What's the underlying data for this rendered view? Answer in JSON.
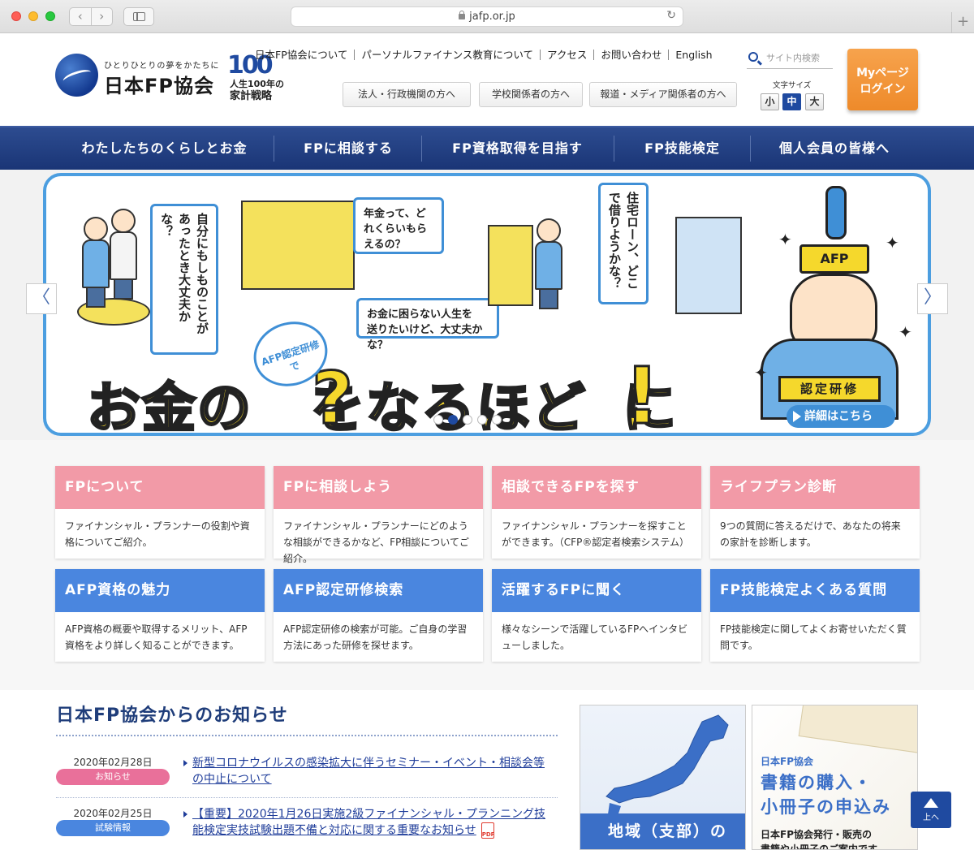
{
  "browser": {
    "url": "jafp.or.jp",
    "back": "‹",
    "forward": "›",
    "new_tab": "+"
  },
  "header": {
    "logo_tagline": "ひとりひとりの夢をかたちに",
    "logo_name": "日本FP協会",
    "centennial_mark": "100",
    "centennial_line1": "人生100年の",
    "centennial_line2": "家計戦略",
    "top_links": [
      "日本FP協会について",
      "パーソナルファイナンス教育について",
      "アクセス",
      "お問い合わせ",
      "English"
    ],
    "search_placeholder": "サイト内検索",
    "audience_buttons": [
      "法人・行政機関の方へ",
      "学校関係者の方へ",
      "報道・メディア関係者の方へ"
    ],
    "font_size_label": "文字サイズ",
    "font_sizes": [
      "小",
      "中",
      "大"
    ],
    "font_size_selected": "中",
    "mypage_line1": "Myページ",
    "mypage_line2": "ログイン"
  },
  "main_nav": [
    "わたしたちのくらしとお金",
    "FPに相談する",
    "FP資格取得を目指す",
    "FP技能検定",
    "個人会員の皆様へ"
  ],
  "hero": {
    "bubble1": "自分にもしものことがあったとき大丈夫かな？",
    "bubble2": "年金って、どれくらいもらえるの？",
    "bubble3_line1": "お金に困らない人生を",
    "bubble3_line2": "送りたいけど、大丈夫かな？",
    "bubble4": "住宅ローン、どこで借りようかな？",
    "badge": "AFP認定研修で",
    "title_part1": "お金の",
    "title_part2": "をなるほど",
    "title_part3": "に",
    "hat_label": "AFP",
    "certification_label": "認定研修",
    "detail_button": "詳細はこちら",
    "slide_count": 5,
    "active_slide": 2,
    "prev": "〈",
    "next": "〉"
  },
  "cards": [
    {
      "title": "FPについて",
      "desc": "ファイナンシャル・プランナーの役割や資格についてご紹介。",
      "color": "pink"
    },
    {
      "title": "FPに相談しよう",
      "desc": "ファイナンシャル・プランナーにどのような相談ができるかなど、FP相談についてご紹介。",
      "color": "pink"
    },
    {
      "title": "相談できるFPを探す",
      "desc": "ファイナンシャル・プランナーを探すことができます。（CFP®認定者検索システム）",
      "color": "pink"
    },
    {
      "title": "ライフプラン診断",
      "desc": "9つの質問に答えるだけで、あなたの将来の家計を診断します。",
      "color": "pink"
    },
    {
      "title": "AFP資格の魅力",
      "desc": "AFP資格の概要や取得するメリット、AFP資格をより詳しく知ることができます。",
      "color": "blue"
    },
    {
      "title": "AFP認定研修検索",
      "desc": "AFP認定研修の検索が可能。ご自身の学習方法にあった研修を探せます。",
      "color": "blue"
    },
    {
      "title": "活躍するFPに聞く",
      "desc": "様々なシーンで活躍しているFPへインタビューしました。",
      "color": "blue"
    },
    {
      "title": "FP技能検定よくある質問",
      "desc": "FP技能検定に関してよくお寄せいただく質問です。",
      "color": "blue"
    }
  ],
  "news": {
    "title": "日本FP協会からのお知らせ",
    "items": [
      {
        "date": "2020年02月28日",
        "category": "お知らせ",
        "text": "新型コロナウイルスの感染拡大に伴うセミナー・イベント・相談会等の中止について"
      },
      {
        "date": "2020年02月25日",
        "category": "試験情報",
        "text": "【重要】2020年1月26日実施2級ファイナンシャル・プランニング技能検定実技試験出題不備と対応に関する重要なお知らせ",
        "pdf": "PDF"
      }
    ]
  },
  "promos": {
    "map_label": "地域（支部）の",
    "book_sub": "日本FP協会",
    "book_title_line1": "書籍の購入・",
    "book_title_line2": "小冊子の申込み",
    "book_desc_line1": "日本FP協会発行・販売の",
    "book_desc_line2": "書籍や小冊子のご案内です"
  },
  "to_top": "上へ",
  "colors": {
    "brand_navy": "#1f4aa0",
    "card_pink": "#f29aa7",
    "card_blue": "#4a86df",
    "mypage_orange": "#ee8a2a",
    "hero_yellow": "#f5d82c"
  }
}
